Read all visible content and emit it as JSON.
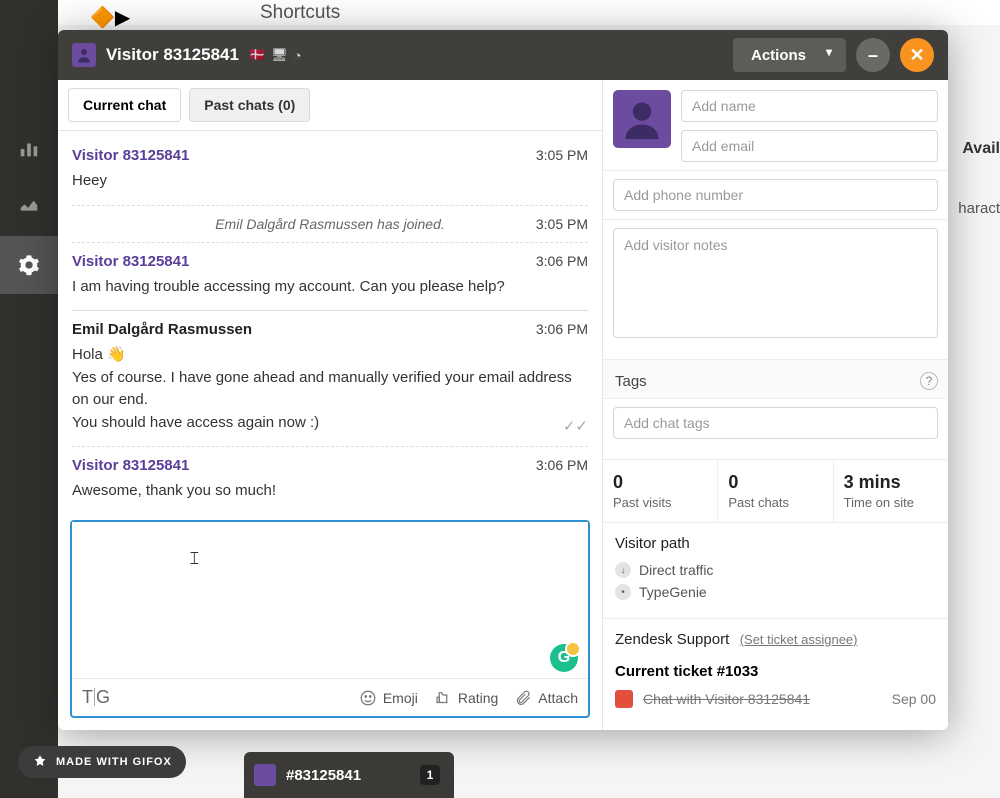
{
  "backdrop": {
    "shortcuts": "Shortcuts",
    "avail": "Avail",
    "charac": "haract"
  },
  "titlebar": {
    "visitor": "Visitor 83125841",
    "actions": "Actions"
  },
  "tabs": {
    "current": "Current chat",
    "past": "Past chats (0)"
  },
  "messages": [
    {
      "type": "visitor",
      "sender": "Visitor 83125841",
      "time": "3:05 PM",
      "body": "Heey"
    },
    {
      "type": "system",
      "text": "Emil Dalgård Rasmussen has joined.",
      "time": "3:05 PM"
    },
    {
      "type": "visitor",
      "sender": "Visitor 83125841",
      "time": "3:06 PM",
      "body": "I am having trouble accessing my account. Can you please help?"
    },
    {
      "type": "agent",
      "sender": "Emil Dalgård Rasmussen",
      "time": "3:06 PM",
      "body1": "Hola 👋",
      "body2": "Yes of course. I have gone ahead and manually verified your email address on our end.",
      "body3": "You should have access again now :)"
    },
    {
      "type": "visitor",
      "sender": "Visitor 83125841",
      "time": "3:06 PM",
      "body": "Awesome, thank you so much!"
    }
  ],
  "composer": {
    "emoji": "Emoji",
    "rating": "Rating",
    "attach": "Attach"
  },
  "profile": {
    "name_ph": "Add name",
    "email_ph": "Add email",
    "phone_ph": "Add phone number",
    "notes_ph": "Add visitor notes"
  },
  "tags": {
    "label": "Tags",
    "placeholder": "Add chat tags"
  },
  "stats": {
    "visits_num": "0",
    "visits_lbl": "Past visits",
    "chats_num": "0",
    "chats_lbl": "Past chats",
    "time_num": "3 mins",
    "time_lbl": "Time on site"
  },
  "path": {
    "label": "Visitor path",
    "direct": "Direct traffic",
    "typegenie": "TypeGenie"
  },
  "zendesk": {
    "support": "Zendesk Support",
    "assignee": "(Set ticket assignee)",
    "current": "Current ticket #1033",
    "chatline": "Chat with Visitor 83125841",
    "date": "Sep 00"
  },
  "footer": {
    "id": "#83125841",
    "badge": "1"
  },
  "gifox": "MADE WITH GIFOX"
}
